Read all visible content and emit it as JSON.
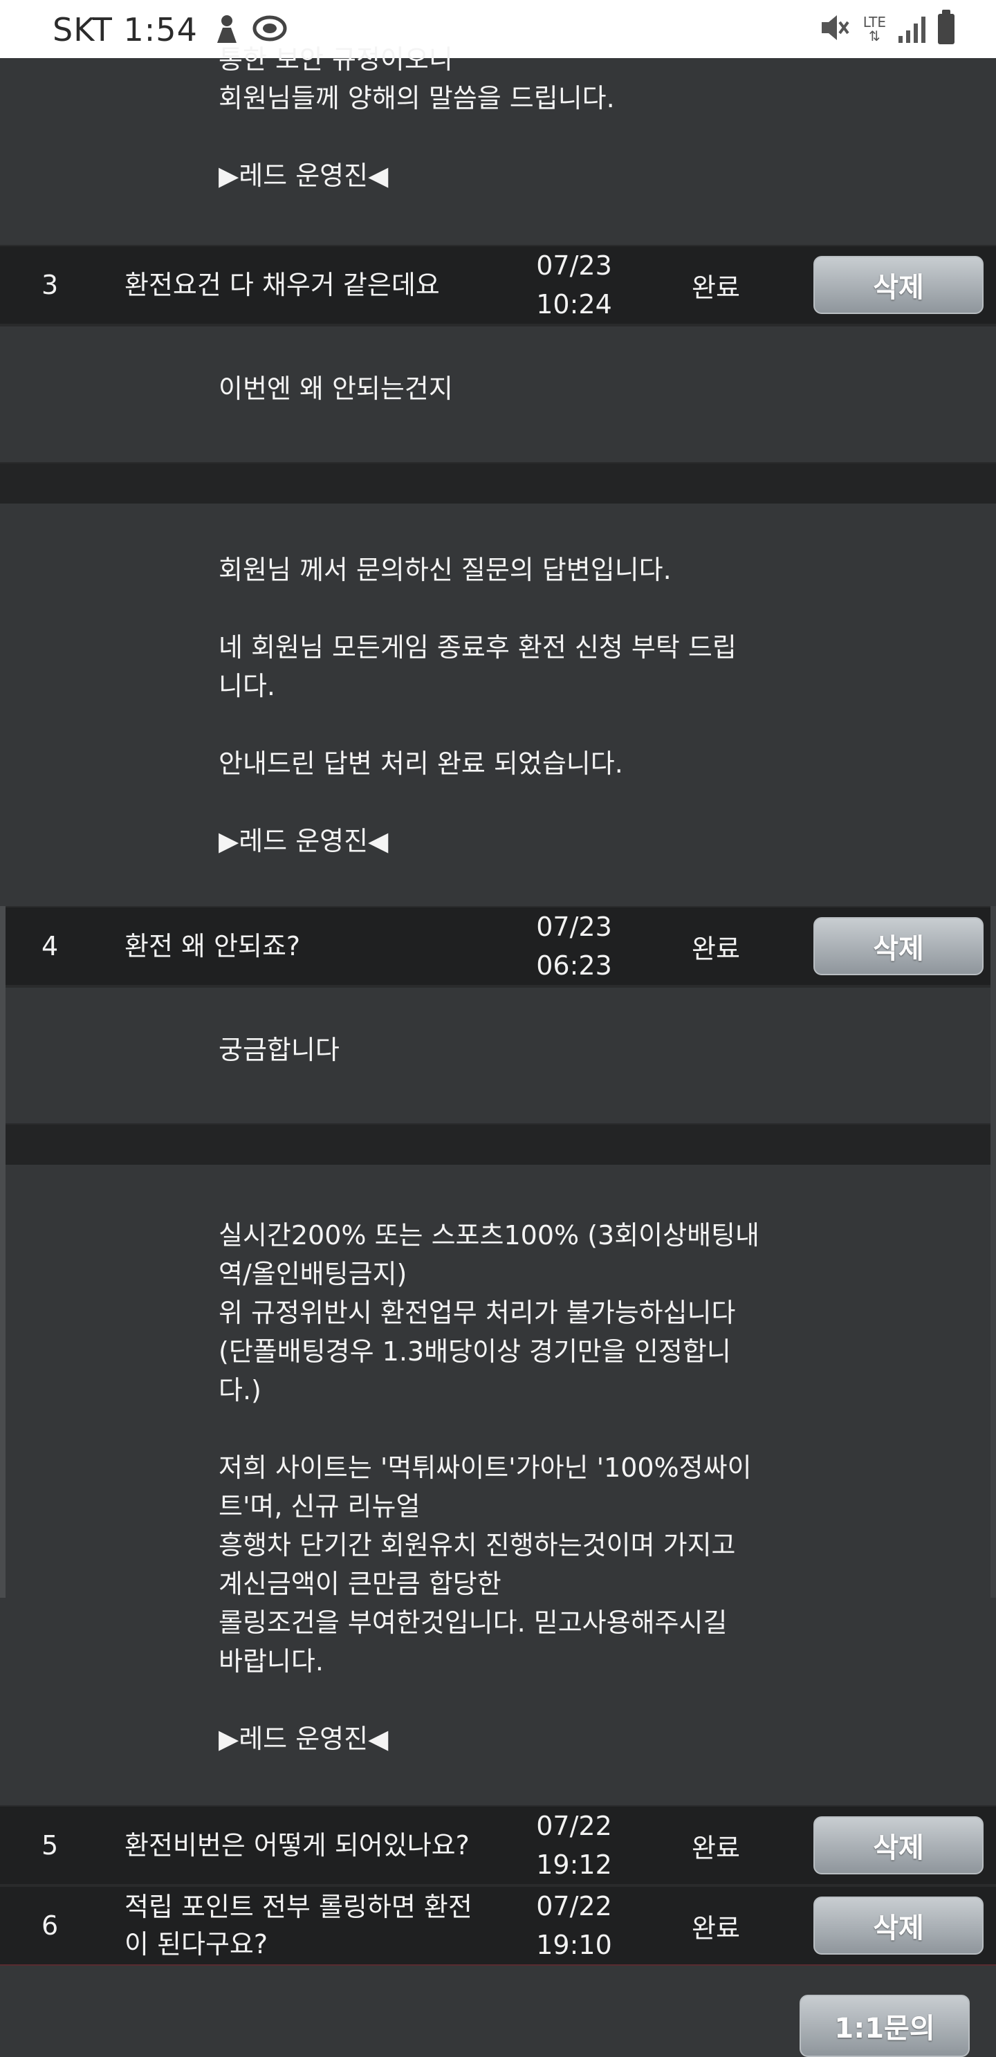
{
  "status_bar": {
    "carrier": "SKT",
    "time": "1:54",
    "lte": "LTE",
    "icons": [
      "app-notification-icon",
      "app-notification-icon-2",
      "mute-icon",
      "lte-icon",
      "signal-icon",
      "battery-icon"
    ]
  },
  "top_answer": {
    "lines": "통한 보안 규정이오니\n회원님들께 양해의 말씀을 드립니다.\n\n▶레드 운영진◀"
  },
  "rows": [
    {
      "num": "3",
      "title": "환전요건 다 채우거 같은데요",
      "date": "07/23",
      "time": "10:24",
      "status": "완료",
      "delete_label": "삭제",
      "question": "이번엔 왜 안되는건지",
      "answer": "회원님 께서 문의하신 질문의 답변입니다.\n\n네 회원님 모든게임 종료후 환전 신청 부탁 드립\n니다.\n\n안내드린 답변 처리 완료 되었습니다.\n\n▶레드 운영진◀"
    },
    {
      "num": "4",
      "title": "환전 왜 안되죠?",
      "date": "07/23",
      "time": "06:23",
      "status": "완료",
      "delete_label": "삭제",
      "question": "궁금합니다",
      "answer": "실시간200% 또는 스포츠100% (3회이상배팅내\n역/올인배팅금지)\n위 규정위반시 환전업무 처리가 불가능하십니다\n(단폴배팅경우 1.3배당이상 경기만을 인정합니\n다.)\n\n저희 사이트는 '먹튀싸이트'가아닌 '100%정싸이\n트'며, 신규 리뉴얼\n흥행차 단기간 회원유치 진행하는것이며 가지고\n계신금액이 큰만큼 합당한\n롤링조건을 부여한것입니다. 믿고사용해주시길\n바랍니다.\n\n▶레드 운영진◀"
    },
    {
      "num": "5",
      "title": "환전비번은 어떻게 되어있나요?",
      "date": "07/22",
      "time": "19:12",
      "status": "완료",
      "delete_label": "삭제"
    },
    {
      "num": "6",
      "title": "적립 포인트 전부 롤링하면 환전\n이 된다구요?",
      "date": "07/22",
      "time": "19:10",
      "status": "완료",
      "delete_label": "삭제"
    }
  ],
  "footer": {
    "inquiry_button": "1:1문의"
  }
}
